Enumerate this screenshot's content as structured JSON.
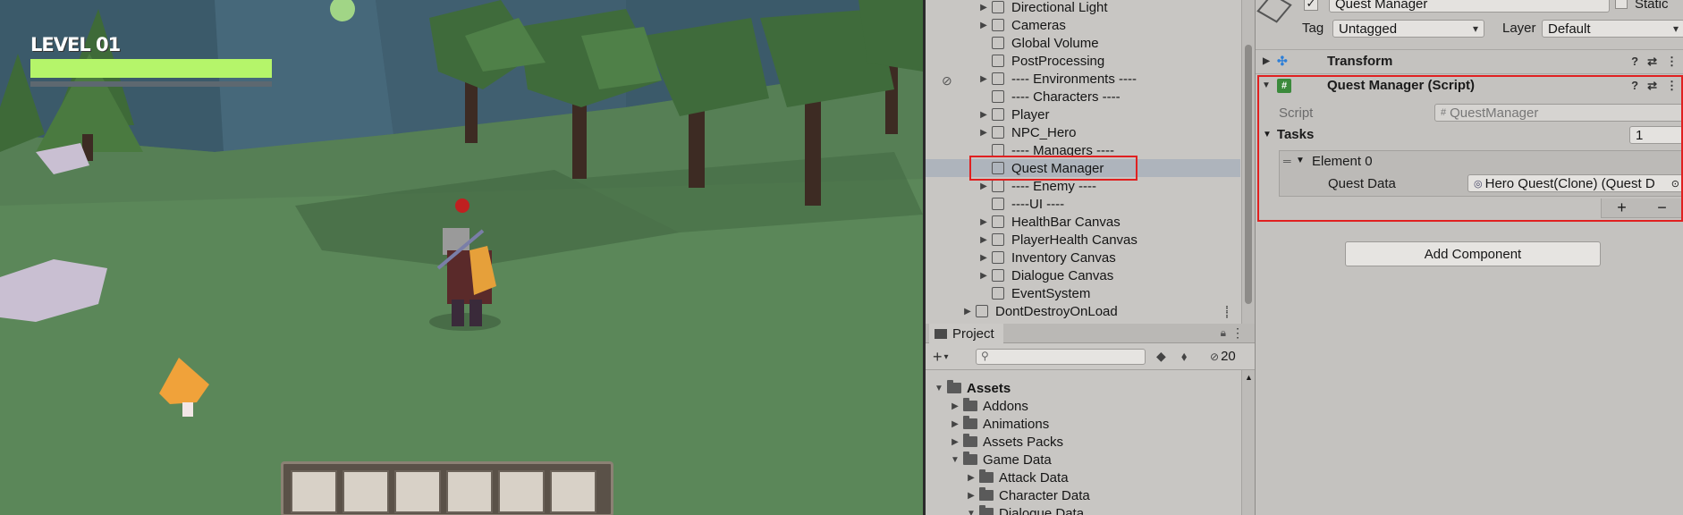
{
  "game_view": {
    "level_label": "LEVEL 01",
    "level_progress": 1.0,
    "hotbar_slots": 6
  },
  "hierarchy": {
    "items": [
      {
        "label": "Directional Light",
        "expand": true,
        "kind": "object"
      },
      {
        "label": "Cameras",
        "expand": true,
        "kind": "object"
      },
      {
        "label": "Global Volume",
        "expand": false,
        "kind": "object"
      },
      {
        "label": "PostProcessing",
        "expand": false,
        "kind": "object"
      },
      {
        "label": "---- Environments ----",
        "expand": true,
        "kind": "object"
      },
      {
        "label": "---- Characters ----",
        "expand": false,
        "kind": "object"
      },
      {
        "label": "Player",
        "expand": true,
        "kind": "object"
      },
      {
        "label": "NPC_Hero",
        "expand": true,
        "kind": "object"
      },
      {
        "label": "---- Managers ----",
        "expand": false,
        "kind": "object"
      },
      {
        "label": "Quest Manager",
        "expand": false,
        "kind": "object",
        "selected": true
      },
      {
        "label": "---- Enemy ----",
        "expand": true,
        "kind": "object"
      },
      {
        "label": "----UI ----",
        "expand": false,
        "kind": "object"
      },
      {
        "label": "HealthBar Canvas",
        "expand": true,
        "kind": "object"
      },
      {
        "label": "PlayerHealth Canvas",
        "expand": true,
        "kind": "object"
      },
      {
        "label": "Inventory Canvas",
        "expand": true,
        "kind": "object"
      },
      {
        "label": "Dialogue Canvas",
        "expand": true,
        "kind": "object"
      },
      {
        "label": "EventSystem",
        "expand": false,
        "kind": "object"
      },
      {
        "label": "DontDestroyOnLoad",
        "expand": true,
        "kind": "scene"
      }
    ]
  },
  "project": {
    "tab_label": "Project",
    "add_label": "+",
    "search_placeholder": "",
    "hidden_count": "20",
    "folders": [
      {
        "label": "Assets",
        "indent": 0,
        "open": true,
        "bold": true
      },
      {
        "label": "Addons",
        "indent": 1,
        "open": false
      },
      {
        "label": "Animations",
        "indent": 1,
        "open": false
      },
      {
        "label": "Assets Packs",
        "indent": 1,
        "open": false
      },
      {
        "label": "Game Data",
        "indent": 1,
        "open": true
      },
      {
        "label": "Attack Data",
        "indent": 2,
        "open": false
      },
      {
        "label": "Character Data",
        "indent": 2,
        "open": false
      },
      {
        "label": "Dialogue Data",
        "indent": 2,
        "open": true
      }
    ]
  },
  "inspector": {
    "object_name": "Quest Manager",
    "static_label": "Static",
    "tag_label": "Tag",
    "tag_value": "Untagged",
    "layer_label": "Layer",
    "layer_value": "Default",
    "transform_label": "Transform",
    "component_title": "Quest Manager (Script)",
    "script_label": "Script",
    "script_value": "QuestManager",
    "tasks_label": "Tasks",
    "tasks_count": "1",
    "element_label": "Element 0",
    "quest_data_label": "Quest Data",
    "quest_data_value": "Hero Quest(Clone) (Quest D",
    "add_component_label": "Add Component",
    "plus_label": "+",
    "minus_label": "−"
  },
  "colors": {
    "selection_box": "#e02020",
    "level_bar": "#b5f56a",
    "panel_bg": "#c8c6c3"
  }
}
